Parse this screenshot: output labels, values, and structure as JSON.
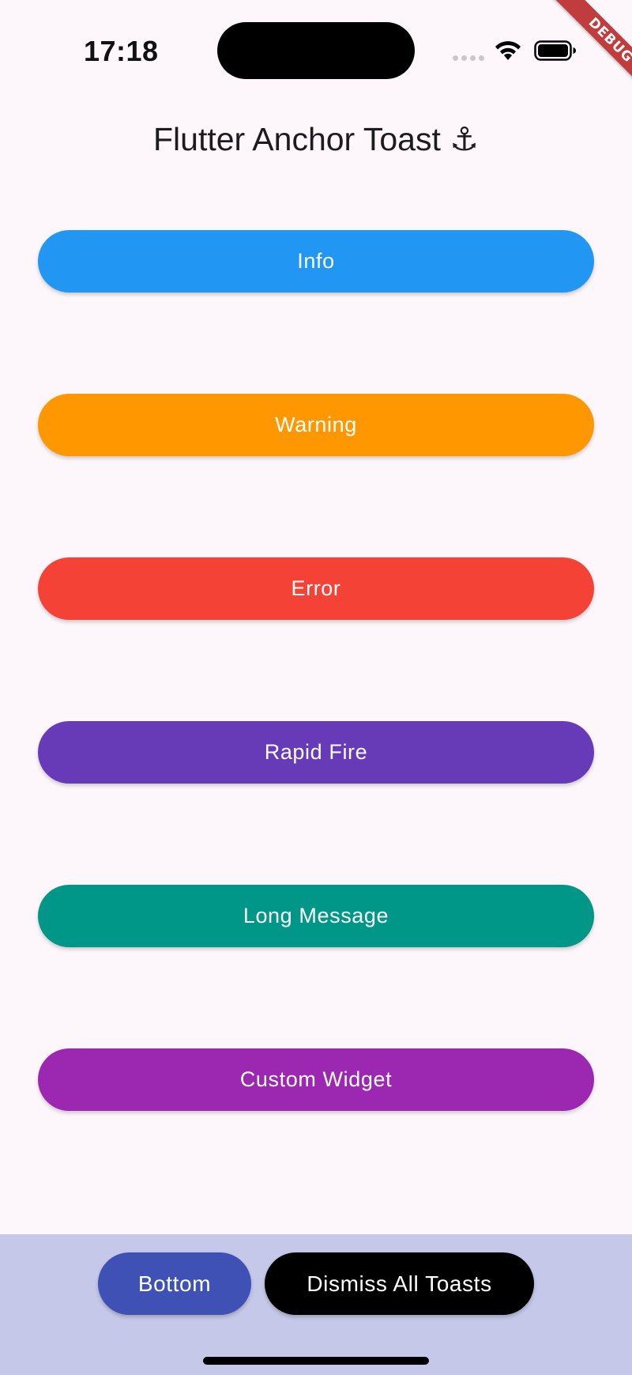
{
  "status_bar": {
    "time": "17:18",
    "icons": [
      "cellular-signal-icon",
      "wifi-icon",
      "battery-icon"
    ]
  },
  "debug_banner": {
    "label": "DEBUG",
    "color": "#b71c1c"
  },
  "header": {
    "title": "Flutter Anchor Toast ⚓"
  },
  "buttons": [
    {
      "label": "Info",
      "color": "#2196f3"
    },
    {
      "label": "Warning",
      "color": "#ff9800"
    },
    {
      "label": "Error",
      "color": "#f44336"
    },
    {
      "label": "Rapid Fire",
      "color": "#673ab7"
    },
    {
      "label": "Long Message",
      "color": "#009688"
    },
    {
      "label": "Custom Widget",
      "color": "#9c27b0"
    }
  ],
  "bottom_bar": {
    "background": "#c5c8e8",
    "position_button": {
      "label": "Bottom",
      "color": "#3f51b5"
    },
    "dismiss_button": {
      "label": "Dismiss All Toasts",
      "color": "#000000"
    }
  }
}
